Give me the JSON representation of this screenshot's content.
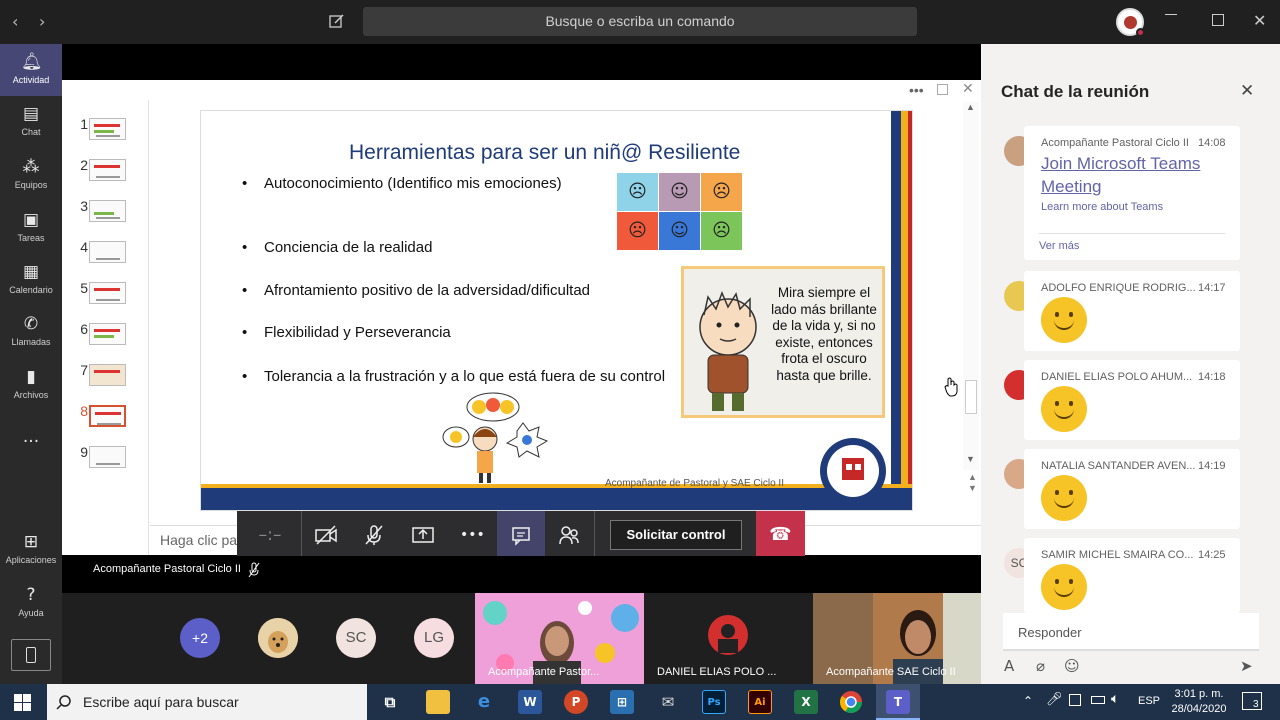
{
  "topbar": {
    "back_icon": "‹",
    "forward_icon": "›",
    "search_placeholder": "Busque o escriba un comando"
  },
  "rail": {
    "items": [
      {
        "label": "Actividad",
        "icon": "bell-icon"
      },
      {
        "label": "Chat",
        "icon": "chat-icon"
      },
      {
        "label": "Equipos",
        "icon": "teams-icon"
      },
      {
        "label": "Tareas",
        "icon": "assignments-icon"
      },
      {
        "label": "Calendario",
        "icon": "calendar-icon"
      },
      {
        "label": "Llamadas",
        "icon": "phone-icon"
      },
      {
        "label": "Archivos",
        "icon": "files-icon"
      },
      {
        "label": "...",
        "icon": "more-icon"
      },
      {
        "label": "Aplicaciones",
        "icon": "apps-icon"
      },
      {
        "label": "Ayuda",
        "icon": "help-icon"
      }
    ]
  },
  "slides": {
    "numbers": [
      "1",
      "2",
      "3",
      "4",
      "5",
      "6",
      "7",
      "8",
      "9"
    ],
    "selected": "8"
  },
  "slide": {
    "title": "Herramientas para ser un niñ@ Resiliente",
    "bullets": [
      "Autoconocimiento (Identifico mis emociones)",
      "Conciencia de la realidad",
      "Afrontamiento positivo de la adversidad/dificultad",
      "Flexibilidad y Perseverancia",
      "Tolerancia a la frustración y a lo que está fuera de su control"
    ],
    "quote": "Mira siempre el lado más brillante de la vida y, si no existe, entonces frota el oscuro hasta que brille.",
    "footer": "Acompañante de Pastoral y SAE Ciclo II",
    "bullet_symbol": "•"
  },
  "notes_placeholder": "Haga clic para agregar notas",
  "controls": {
    "request_control": "Solicitar control",
    "icons": [
      "camera-off-icon",
      "mic-off-icon",
      "share-icon",
      "more-icon",
      "chat-icon",
      "participants-icon",
      "hangup-icon"
    ]
  },
  "presenter": {
    "name": "Acompañante Pastoral Ciclo II"
  },
  "participants": {
    "overflow": "+2",
    "initials_1": "SC",
    "initials_2": "LG",
    "videos": [
      "Acompañante Pastor...",
      "DANIEL ELIAS POLO ...",
      "Acompañante SAE Ciclo II"
    ]
  },
  "chat": {
    "title": "Chat de la reunión",
    "first": {
      "sender": "Acompañante Pastoral Ciclo II",
      "time": "14:08",
      "link": "Join Microsoft Teams Meeting",
      "learn_more": "Learn more about Teams",
      "see_more": "Ver más"
    },
    "messages": [
      {
        "sender": "ADOLFO ENRIQUE RODRIG...",
        "time": "14:17"
      },
      {
        "sender": "DANIEL ELIAS POLO AHUM...",
        "time": "14:18"
      },
      {
        "sender": "NATALIA SANTANDER AVEN...",
        "time": "14:19"
      },
      {
        "sender": "SAMIR MICHEL SMAIRA CO...",
        "time": "14:25"
      }
    ],
    "sc_initials": "SC",
    "reply_placeholder": "Responder"
  },
  "taskbar": {
    "search_placeholder": "Escribe aquí para buscar",
    "lang": "ESP",
    "time": "3:01 p. m.",
    "date": "28/04/2020",
    "notifications": "3",
    "word": "W",
    "powerpoint": "P",
    "photoshop": "Ps",
    "illustrator": "Ai",
    "excel": "X",
    "teams": "T"
  },
  "colors": {
    "rail_active": "#464775",
    "hangup": "#c4314b",
    "link": "#6264a7",
    "taskbar": "#1e3149"
  }
}
